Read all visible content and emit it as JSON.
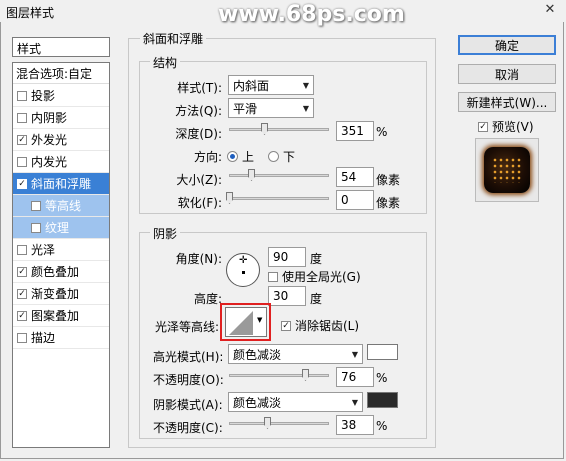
{
  "window": {
    "title": "图层样式",
    "watermark": "www.68ps.com",
    "close_glyph": "✕"
  },
  "left": {
    "header": "样式",
    "blend_options": "混合选项:自定",
    "items": [
      {
        "label": "投影",
        "checked": false
      },
      {
        "label": "内阴影",
        "checked": false
      },
      {
        "label": "外发光",
        "checked": true
      },
      {
        "label": "内发光",
        "checked": false
      },
      {
        "label": "斜面和浮雕",
        "checked": true,
        "selected": true
      },
      {
        "label": "等高线",
        "checked": false,
        "sub": true
      },
      {
        "label": "纹理",
        "checked": false,
        "sub": true
      },
      {
        "label": "光泽",
        "checked": false
      },
      {
        "label": "颜色叠加",
        "checked": true
      },
      {
        "label": "渐变叠加",
        "checked": true
      },
      {
        "label": "图案叠加",
        "checked": true
      },
      {
        "label": "描边",
        "checked": false
      }
    ]
  },
  "bevel": {
    "group_title": "斜面和浮雕",
    "structure": {
      "title": "结构",
      "style_label": "样式(T):",
      "style_value": "内斜面",
      "technique_label": "方法(Q):",
      "technique_value": "平滑",
      "depth_label": "深度(D):",
      "depth_value": "351",
      "depth_unit": "%",
      "depth_level": 0.35,
      "direction_label": "方向:",
      "dir_up": "上",
      "dir_down": "下",
      "size_label": "大小(Z):",
      "size_value": "54",
      "size_unit": "像素",
      "size_level": 0.22,
      "soften_label": "软化(F):",
      "soften_value": "0",
      "soften_unit": "像素",
      "soften_level": 0
    },
    "shading": {
      "title": "阴影",
      "angle_label": "角度(N):",
      "angle_value": "90",
      "angle_unit": "度",
      "global_light_label": "使用全局光(G)",
      "altitude_label": "高度:",
      "altitude_value": "30",
      "altitude_unit": "度",
      "gloss_label": "光泽等高线:",
      "antialias_label": "消除锯齿(L)",
      "highlight_label": "高光模式(H):",
      "highlight_mode": "颜色减淡",
      "highlight_color": "#ffffff",
      "hl_opacity_label": "不透明度(O):",
      "hl_opacity_value": "76",
      "hl_opacity_unit": "%",
      "hl_opacity_level": 0.76,
      "shadow_label": "阴影模式(A):",
      "shadow_mode": "颜色减淡",
      "shadow_color": "#2a2a2a",
      "sh_opacity_label": "不透明度(C):",
      "sh_opacity_value": "38",
      "sh_opacity_unit": "%",
      "sh_opacity_level": 0.38
    }
  },
  "right": {
    "ok": "确定",
    "cancel": "取消",
    "new_style": "新建样式(W)...",
    "preview": "预览(V)"
  },
  "colors": {
    "accent": "#3a80d5",
    "sub_selected": "#9ec3ee",
    "highlight_box": "#e02020"
  }
}
